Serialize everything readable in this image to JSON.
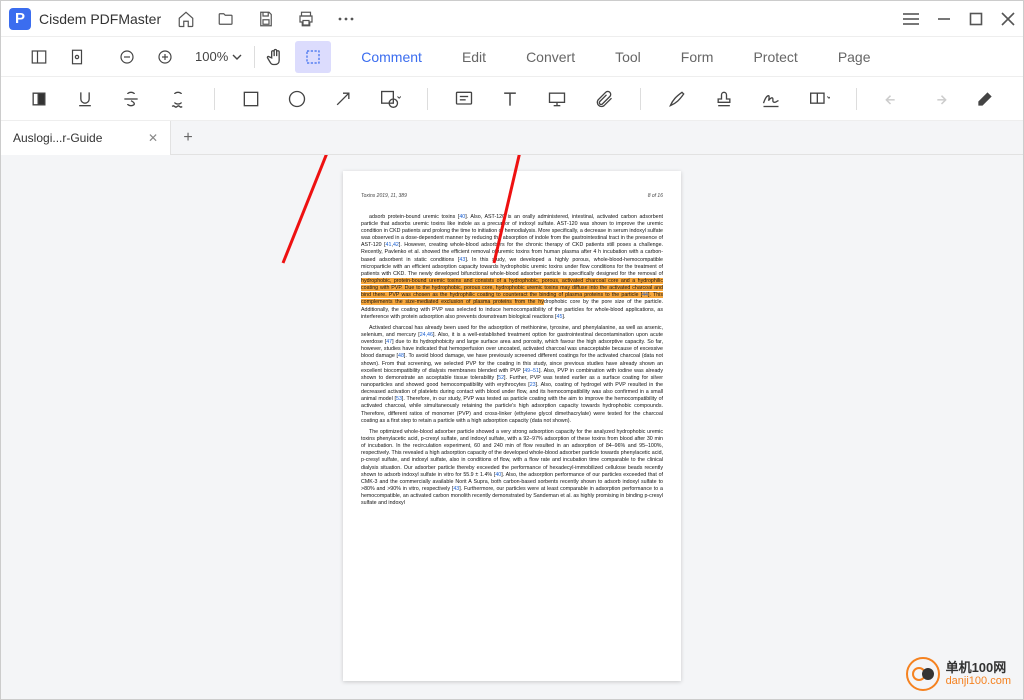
{
  "app": {
    "title": "Cisdem PDFMaster",
    "logo_letter": "P"
  },
  "menu": {
    "comment": "Comment",
    "edit": "Edit",
    "convert": "Convert",
    "tool": "Tool",
    "form": "Form",
    "protect": "Protect",
    "page": "Page"
  },
  "zoom": {
    "value": "100%"
  },
  "tab": {
    "label": "Auslogi...r-Guide"
  },
  "doc": {
    "journal": "Toxins 2019, 11, 389",
    "pageno": "8 of 16",
    "p1a": "adsorb protein-bound uremic toxins [",
    "r40": "40",
    "p1b": "]. Also, AST-120 is an orally administered, intestinal, activated carbon adsorbent particle that adsorbs uremic toxins like indole as a precursor of indoxyl sulfate. AST-120 was shown to improve the uremic condition in CKD patients and prolong the time to initiation of hemodialysis. More specifically, a decrease in serum indoxyl sulfate was observed in a dose-dependent manner by reducing the absorption of indole from the gastrointestinal tract in the presence of AST-120 [",
    "r41": "41",
    "p1c": ",",
    "r42": "42",
    "p1d": "]. However, creating whole-blood adsorbers for the chronic therapy of CKD patients still poses a challenge. Recently, Pavlenko et al. showed the efficient removal of uremic toxins from human plasma after 4 h incubation with a carbon-based adsorbent in static conditions [",
    "r43": "43",
    "p1e": "]. In this study, we developed a highly porous, whole-blood-hemocompatible microparticle with an efficient adsorption capacity towards hydrophobic uremic toxins under flow conditions for the treatment of patients with CKD. The newly developed bifunctional whole-blood adsorber particle is specifically designed for the removal of ",
    "hl1": "hydrophobic, protein-bound uremic toxins and consists of a hydrophobic, porous, activated charcoal core and a hydrophilic coating with PVP. Due to the hydrophobic, porous core, hydrophobic uremic toxins may diffuse into the activated charcoal and bind there. PVP was chosen as the hydrophilic coating to counteract the binding of plasma proteins to the particle [",
    "r44": "44",
    "hl2": "]. This complements the size-mediated exclusion of plasma proteins from the hy",
    "p1f": "drophobic core by the pore size of the particle. Additionally, the coating with PVP was selected to induce hemocompatibility of the particles for whole-blood applications, as interference with protein adsorption also prevents downstream biological reactions [",
    "r45": "45",
    "p1g": "].",
    "p2a": "Activated charcoal has already been used for the adsorption of methionine, tyrosine, and phenylalanine, as well as arsenic, selenium, and mercury [",
    "r2446": "24,46",
    "p2b": "]. Also, it is a well-established treatment option for gastrointestinal decontamination upon acute overdose [",
    "r47": "47",
    "p2c": "] due to its hydrophobicity and large surface area and porosity, which favour the high adsorptive capacity. So far, however, studies have indicated that hemoperfusion over uncoated, activated charcoal was unacceptable because of excessive blood damage [",
    "r48": "48",
    "p2d": "]. To avoid blood damage, we have previously screened different coatings for the activated charcoal (data not shown). From that screening, we selected PVP for the coating in this study, since previous studies have already shown an excellent biocompatibility of dialysis membranes blended with PVP [",
    "r4951": "49–51",
    "p2e": "]. Also, PVP in combination with iodine was already shown to demonstrate an acceptable tissue tolerability [",
    "r52": "52",
    "p2f": "]. Further, PVP was tested earlier as a surface coating for silver nanoparticles and showed good hemocompatibility with erythrocytes [",
    "r23": "23",
    "p2g": "]. Also, coating of hydrogel with PVP resulted in the decreased activation of platelets during contact with blood under flow, and its hemocompatibility was also confirmed in a small animal model [",
    "r53": "53",
    "p2h": "]. Therefore, in our study, PVP was tested as particle coating with the aim to improve the hemocompatibility of activated charcoal, while simultaneously retaining the particle's high adsorption capacity towards hydrophobic compounds. Therefore, different ratios of monomer (PVP) and cross-linker (ethylene glycol dimethacrylate) were tested for the charcoal coating as a first step to retain a particle with a high adsorption capacity (data not shown).",
    "p3a": "The optimized whole-blood adsorber particle showed a very strong adsorption capacity for the analyzed hydrophobic uremic toxins phenylacetic acid, p-cresyl sulfate, and indoxyl sulfate, with a 92–97% adsorption of these toxins from blood after 30 min of incubation. In the recirculation experiment, 60 and 240 min of flow resulted in an adsorption of 84–96% and 95–100%, respectively. This revealed a high adsorption capacity of the developed whole-blood adsorber particle towards phenylacetic acid, p-cresyl sulfate, and indoxyl sulfate, also in conditions of flow, with a flow rate and incubation time comparable to the clinical dialysis situation. Our adsorber particle thereby exceeded the performance of hexadecyl-immobilized cellulose beads recently shown to adsorb indoxyl sulfate in vitro for 55.9 ± 1.4% [",
    "r40b": "40",
    "p3b": "]. Also, the adsorption performance of our particles exceeded that of CMK-3 and the commercially available Norit A Supra, both carbon-based sorbents recently shown to adsorb indoxyl sulfate to >80% and >90% in vitro, respectively [",
    "r43b": "43",
    "p3c": "]. Furthermore, our particles were at least comparable in adsorption performance to a hemocompatible, an activated carbon monolith recently demonstrated by Sandeman et al. as highly promising in binding p-cresyl sulfate and indoxyl"
  },
  "watermark": {
    "line1": "单机100网",
    "line2": "danji100.com"
  }
}
